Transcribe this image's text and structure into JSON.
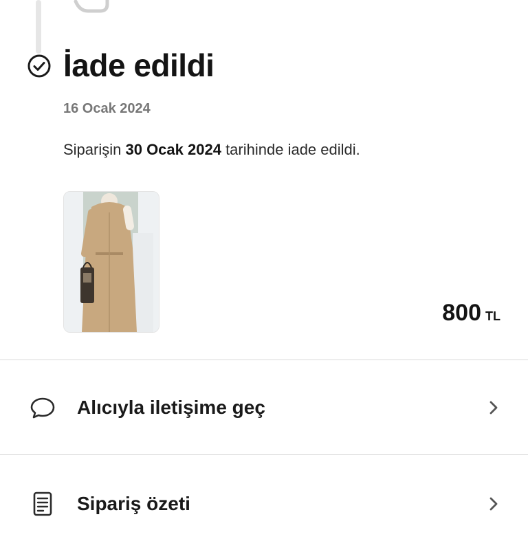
{
  "status": {
    "title": "İade edildi",
    "date": "16 Ocak 2024",
    "message_prefix": "Siparişin ",
    "message_date": "30 Ocak 2024",
    "message_suffix": " tarihinde iade edildi."
  },
  "product": {
    "price_amount": "800",
    "price_currency": "TL"
  },
  "actions": [
    {
      "label": "Alıcıyla iletişime geç",
      "icon": "chat-bubble-icon"
    },
    {
      "label": "Sipariş özeti",
      "icon": "document-list-icon"
    }
  ],
  "colors": {
    "text": "#1a1a1a",
    "muted": "#777777",
    "divider": "#d9d9d9",
    "timeline": "#e6e6e6"
  }
}
